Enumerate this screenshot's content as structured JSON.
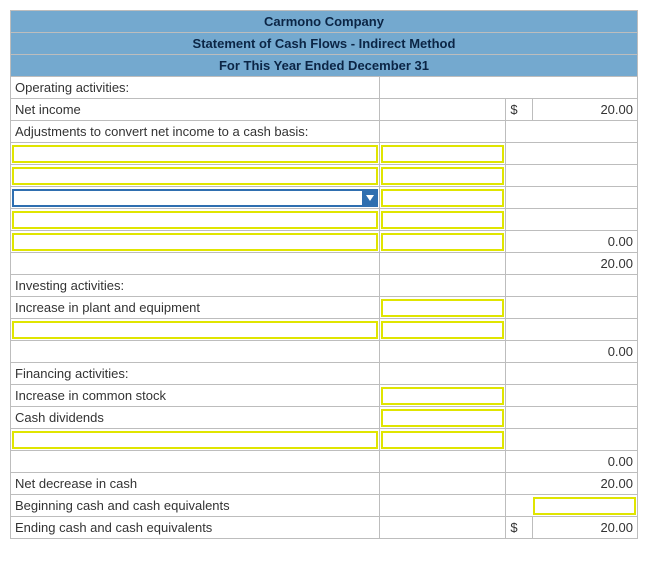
{
  "header": {
    "company": "Carmono Company",
    "statement": "Statement of Cash Flows - Indirect Method",
    "period": "For This Year Ended December 31"
  },
  "labels": {
    "operating": "Operating activities:",
    "net_income": "Net income",
    "adjustments": "Adjustments to convert net income to a cash basis:",
    "investing": "Investing activities:",
    "inc_plant": "Increase in plant and equipment",
    "financing": "Financing activities:",
    "inc_common": "Increase in common stock",
    "cash_div": "Cash dividends",
    "net_decrease": "Net decrease in cash",
    "beg_cash": "Beginning cash and cash equivalents",
    "end_cash": "Ending cash and cash equivalents"
  },
  "currency": "$",
  "values": {
    "net_income": "20.00",
    "op_subtotal": "0.00",
    "op_total": "20.00",
    "inv_total": "0.00",
    "fin_total": "0.00",
    "net_decrease": "20.00",
    "ending": "20.00"
  }
}
